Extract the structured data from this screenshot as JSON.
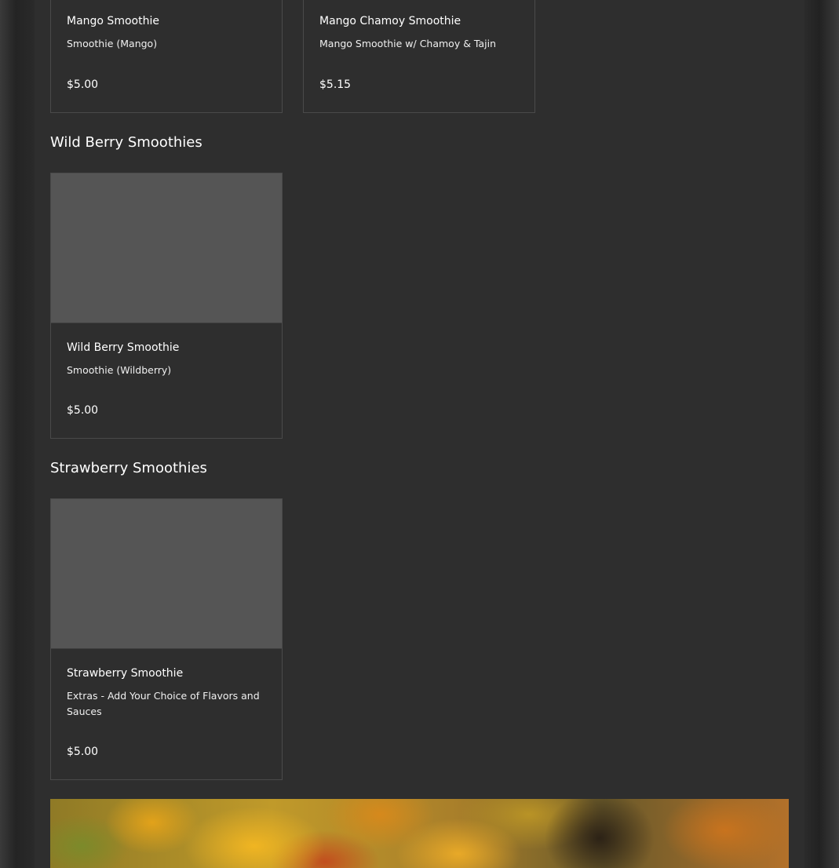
{
  "sections": [
    {
      "title": "",
      "items": [
        {
          "name": "Mango Smoothie",
          "description": "Smoothie (Mango)",
          "price": "$5.00"
        },
        {
          "name": "Mango Chamoy Smoothie",
          "description": "Mango Smoothie w/ Chamoy & Tajin",
          "price": "$5.15"
        }
      ]
    },
    {
      "title": "Wild Berry Smoothies",
      "items": [
        {
          "name": "Wild Berry Smoothie",
          "description": "Smoothie (Wildberry)",
          "price": "$5.00"
        }
      ]
    },
    {
      "title": "Strawberry Smoothies",
      "items": [
        {
          "name": "Strawberry Smoothie",
          "description": "Extras - Add Your Choice of Flavors and Sauces",
          "price": "$5.00"
        }
      ]
    }
  ],
  "colors": {
    "panel": "#2e2e2e",
    "card_border": "#4a4a4a",
    "thumbnail": "#555555",
    "text": "#ffffff"
  }
}
